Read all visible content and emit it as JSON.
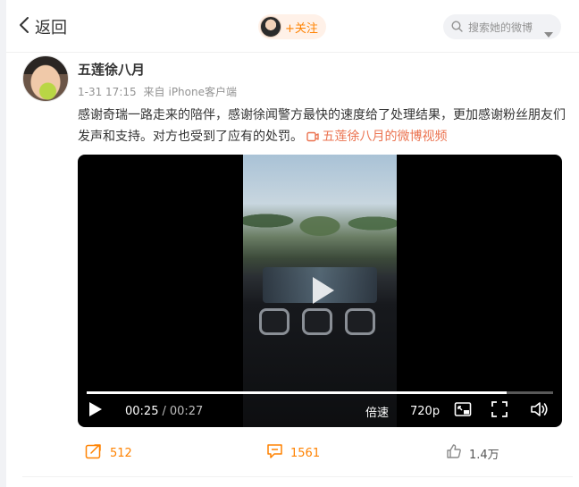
{
  "topbar": {
    "back_label": "返回",
    "follow_label": "+关注",
    "search_placeholder": "搜索她的微博"
  },
  "post": {
    "username": "五莲徐八月",
    "date": "1-31 17:15",
    "source_prefix": "来自",
    "source": "iPhone客户端",
    "text": "感谢奇瑞一路走来的陪伴，感谢徐闻警方最快的速度给了处理结果，更加感谢粉丝朋友们发声和支持。对方也受到了应有的处罚。",
    "video_link_label": "五莲徐八月的微博视频"
  },
  "video": {
    "current_time": "00:25",
    "separator": "/",
    "duration": "00:27",
    "speed_label": "倍速",
    "quality_label": "720p",
    "progress_fraction": 0.9
  },
  "actions": {
    "reposts": "512",
    "comments": "1561",
    "likes": "1.4万"
  },
  "colors": {
    "accent": "#ff8200",
    "link": "#eb7350",
    "muted": "#939393"
  },
  "icons": [
    "chevron-left-icon",
    "search-icon",
    "caret-down-icon",
    "video-link-icon",
    "play-icon",
    "pip-icon",
    "fullscreen-icon",
    "volume-icon",
    "repost-icon",
    "comment-icon",
    "like-icon"
  ]
}
